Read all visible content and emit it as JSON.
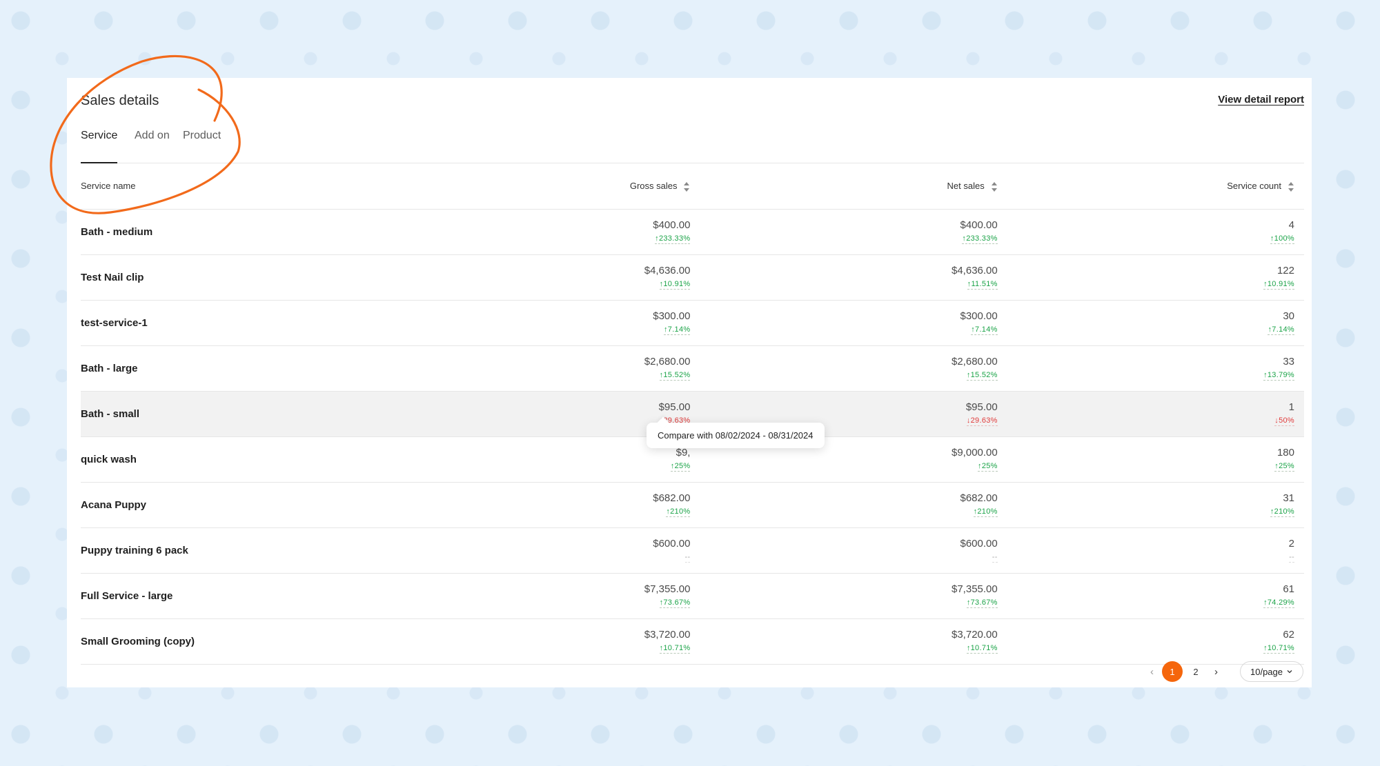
{
  "card": {
    "title": "Sales details",
    "report_link": "View detail report"
  },
  "tabs": [
    {
      "label": "Service",
      "active": true
    },
    {
      "label": "Add on",
      "active": false
    },
    {
      "label": "Product",
      "active": false
    }
  ],
  "columns": {
    "name": "Service name",
    "gross": "Gross sales",
    "net": "Net sales",
    "count": "Service count"
  },
  "rows": [
    {
      "name": "Bath - medium",
      "gross": "$400.00",
      "gross_delta": "233.33%",
      "gross_dir": "up",
      "net": "$400.00",
      "net_delta": "233.33%",
      "net_dir": "up",
      "count": "4",
      "count_delta": "100%",
      "count_dir": "up"
    },
    {
      "name": "Test Nail clip",
      "gross": "$4,636.00",
      "gross_delta": "10.91%",
      "gross_dir": "up",
      "net": "$4,636.00",
      "net_delta": "11.51%",
      "net_dir": "up",
      "count": "122",
      "count_delta": "10.91%",
      "count_dir": "up"
    },
    {
      "name": "test-service-1",
      "gross": "$300.00",
      "gross_delta": "7.14%",
      "gross_dir": "up",
      "net": "$300.00",
      "net_delta": "7.14%",
      "net_dir": "up",
      "count": "30",
      "count_delta": "7.14%",
      "count_dir": "up"
    },
    {
      "name": "Bath - large",
      "gross": "$2,680.00",
      "gross_delta": "15.52%",
      "gross_dir": "up",
      "net": "$2,680.00",
      "net_delta": "15.52%",
      "net_dir": "up",
      "count": "33",
      "count_delta": "13.79%",
      "count_dir": "up"
    },
    {
      "name": "Bath - small",
      "gross": "$95.00",
      "gross_delta": "29.63%",
      "gross_dir": "down",
      "net": "$95.00",
      "net_delta": "29.63%",
      "net_dir": "down",
      "count": "1",
      "count_delta": "50%",
      "count_dir": "down"
    },
    {
      "name": "quick wash",
      "gross": "$9,",
      "gross_delta": "25%",
      "gross_dir": "up",
      "net": "$9,000.00",
      "net_delta": "25%",
      "net_dir": "up",
      "count": "180",
      "count_delta": "25%",
      "count_dir": "up"
    },
    {
      "name": "Acana Puppy",
      "gross": "$682.00",
      "gross_delta": "210%",
      "gross_dir": "up",
      "net": "$682.00",
      "net_delta": "210%",
      "net_dir": "up",
      "count": "31",
      "count_delta": "210%",
      "count_dir": "up"
    },
    {
      "name": "Puppy training 6 pack",
      "gross": "$600.00",
      "gross_delta": "--",
      "gross_dir": "flat",
      "net": "$600.00",
      "net_delta": "--",
      "net_dir": "flat",
      "count": "2",
      "count_delta": "--",
      "count_dir": "flat"
    },
    {
      "name": "Full Service - large",
      "gross": "$7,355.00",
      "gross_delta": "73.67%",
      "gross_dir": "up",
      "net": "$7,355.00",
      "net_delta": "73.67%",
      "net_dir": "up",
      "count": "61",
      "count_delta": "74.29%",
      "count_dir": "up"
    },
    {
      "name": "Small Grooming (copy)",
      "gross": "$3,720.00",
      "gross_delta": "10.71%",
      "gross_dir": "up",
      "net": "$3,720.00",
      "net_delta": "10.71%",
      "net_dir": "up",
      "count": "62",
      "count_delta": "10.71%",
      "count_dir": "up"
    }
  ],
  "hover_row": 4,
  "tooltip": "Compare with 08/02/2024 - 08/31/2024",
  "pagination": {
    "pages": [
      "1",
      "2"
    ],
    "current": "1",
    "page_size": "10/page"
  },
  "colors": {
    "accent": "#f5660c",
    "up": "#1aa347",
    "down": "#e03a3a"
  }
}
